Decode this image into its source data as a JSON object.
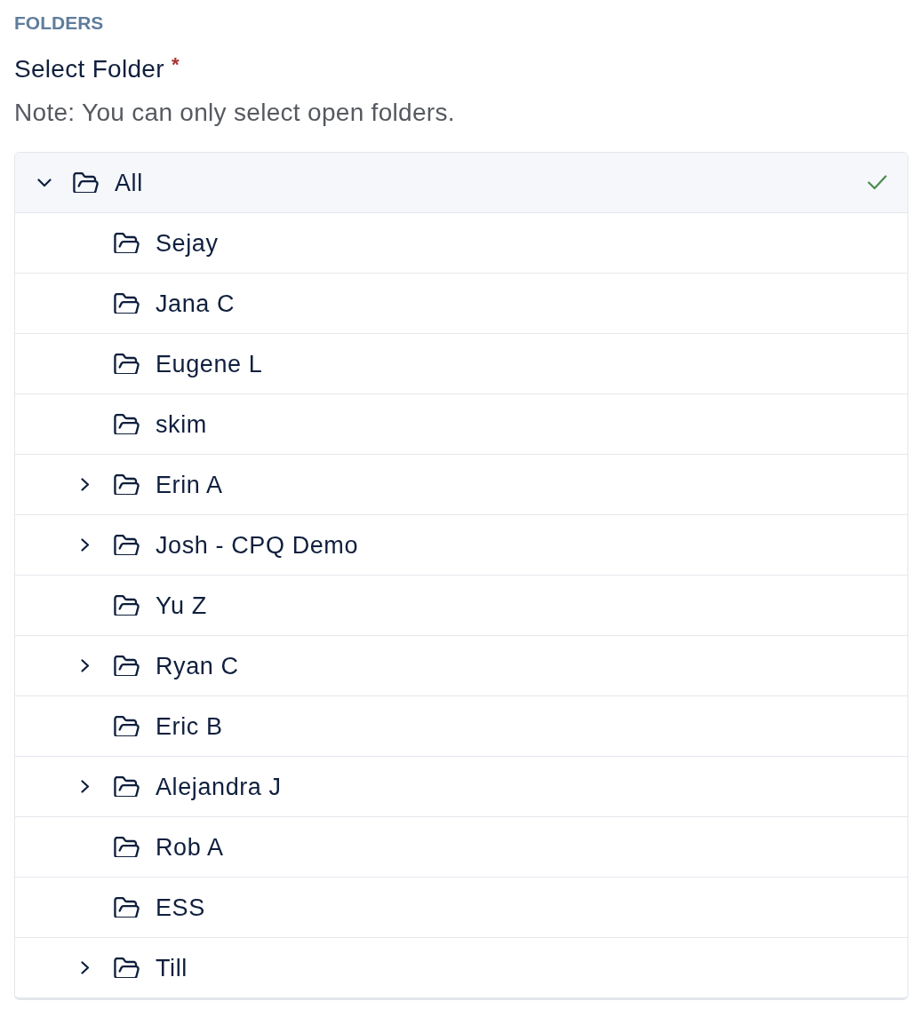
{
  "section_heading": "FOLDERS",
  "field": {
    "label": "Select Folder",
    "required_mark": "*",
    "note": "Note: You can only select open folders."
  },
  "tree": [
    {
      "label": "All",
      "kind": "branch",
      "expanded": true,
      "selected": true,
      "children": [
        {
          "label": "Sejay",
          "kind": "leaf",
          "selected": false
        },
        {
          "label": "Jana C",
          "kind": "leaf",
          "selected": false
        },
        {
          "label": "Eugene L",
          "kind": "leaf",
          "selected": false
        },
        {
          "label": "skim",
          "kind": "leaf",
          "selected": false
        },
        {
          "label": "Erin A",
          "kind": "branch",
          "expanded": false,
          "selected": false
        },
        {
          "label": "Josh - CPQ Demo",
          "kind": "branch",
          "expanded": false,
          "selected": false
        },
        {
          "label": "Yu Z",
          "kind": "leaf",
          "selected": false
        },
        {
          "label": "Ryan C",
          "kind": "branch",
          "expanded": false,
          "selected": false
        },
        {
          "label": "Eric B",
          "kind": "leaf",
          "selected": false
        },
        {
          "label": "Alejandra J",
          "kind": "branch",
          "expanded": false,
          "selected": false
        },
        {
          "label": "Rob A",
          "kind": "leaf",
          "selected": false
        },
        {
          "label": "ESS",
          "kind": "leaf",
          "selected": false
        },
        {
          "label": "Till",
          "kind": "branch",
          "expanded": false,
          "selected": false
        }
      ]
    }
  ]
}
